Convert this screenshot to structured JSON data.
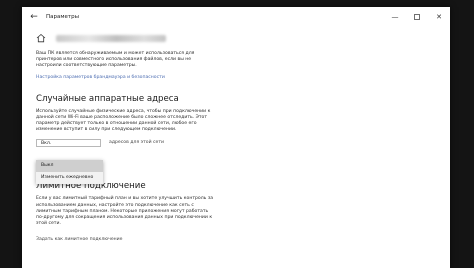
{
  "window": {
    "title": "Параметры",
    "back_glyph": "←",
    "minimize_glyph": "—",
    "close_glyph": "✕"
  },
  "intro": {
    "text": "Ваш ПК является обнаруживаемым и может использоваться для принтеров или совместного использования файлов, если вы не настроили соответствующие параметры."
  },
  "links": {
    "sharing_settings": "Настройка параметров брандмауэра и безопасности"
  },
  "random_hw": {
    "heading": "Случайные аппаратные адреса",
    "description": "Используйте случайные физические адреса, чтобы при подключении к данной сети Wi-Fi ваше расположение было сложнее отследить. Этот параметр действует только в отношении данной сети, любое его изменение вступит в силу при следующем подключении.",
    "dropdown_value": "Вкл.",
    "dropdown_suffix": "адресов для этой сети",
    "options": [
      "Выкл",
      "Изменить ежедневно"
    ]
  },
  "metered": {
    "heading": "Лимитное подключение",
    "description": "Если у вас лимитный тарифный план и вы хотите улучшить контроль за использованием данных, настройте это подключение как сеть с лимитным тарифным планом. Некоторые приложения могут работать по-другому для сокращения использования данных при подключении к этой сети.",
    "footer_link": "Задать как лимитное подключение"
  },
  "icons": {
    "back": "back-arrow-icon",
    "home": "home-icon",
    "minimize": "minimize-icon",
    "maximize": "maximize-icon",
    "close": "close-icon"
  }
}
